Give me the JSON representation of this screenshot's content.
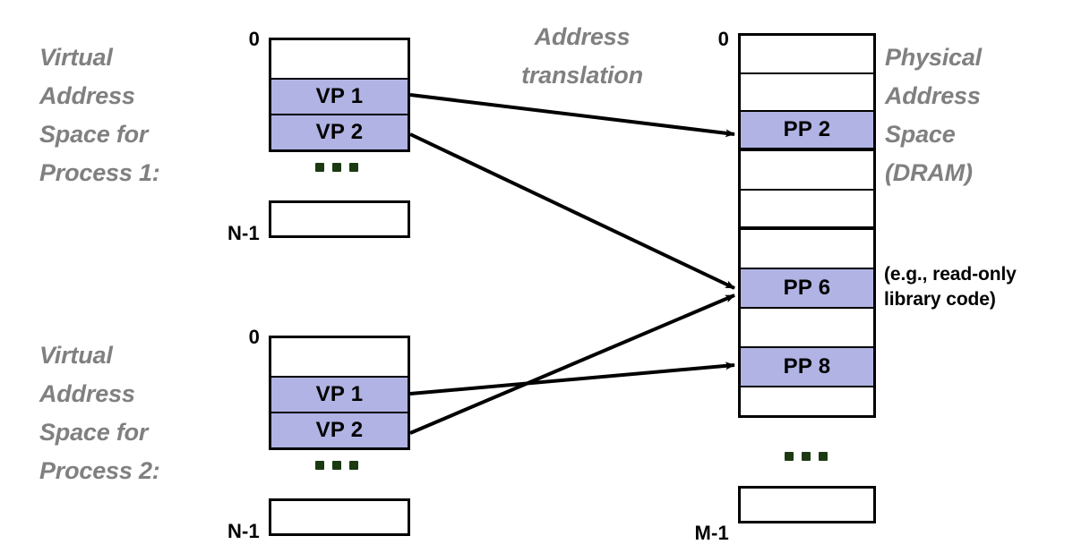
{
  "diagram": {
    "title": "Virtual memory address translation across two processes",
    "colors": {
      "page_fill": "#b0b3e3",
      "caption_gray": "#808080",
      "dot_green": "#1b3a12",
      "stroke": "#000000"
    }
  },
  "captions": {
    "process1": "Virtual\nAddress\nSpace for\nProcess 1:",
    "process2": "Virtual\nAddress\nSpace for\nProcess 2:",
    "translation": "Address\ntranslation",
    "physical": "Physical\nAddress\nSpace\n(DRAM)"
  },
  "notes": {
    "readonly": "(e.g., read-only\nlibrary code)"
  },
  "indices": {
    "vas1_top": "0",
    "vas1_bottom": "N-1",
    "vas2_top": "0",
    "vas2_bottom": "N-1",
    "pas_top": "0",
    "pas_bottom": "M-1"
  },
  "virtual_space_1": {
    "cells": [
      {
        "label": "",
        "filled": false
      },
      {
        "label": "VP 1",
        "filled": true
      },
      {
        "label": "VP 2",
        "filled": true
      }
    ],
    "last_cell": {
      "label": "",
      "filled": false
    }
  },
  "virtual_space_2": {
    "cells": [
      {
        "label": "",
        "filled": false
      },
      {
        "label": "VP 1",
        "filled": true
      },
      {
        "label": "VP 2",
        "filled": true
      }
    ],
    "last_cell": {
      "label": "",
      "filled": false
    }
  },
  "physical_space": {
    "cells": [
      {
        "label": "",
        "filled": false
      },
      {
        "label": "",
        "filled": false
      },
      {
        "label": "PP 2",
        "filled": true
      },
      {
        "label": "",
        "filled": false
      },
      {
        "label": "",
        "filled": false
      },
      {
        "label": "",
        "filled": false
      },
      {
        "label": "PP 6",
        "filled": true
      },
      {
        "label": "",
        "filled": false
      },
      {
        "label": "PP 8",
        "filled": true
      },
      {
        "label": "",
        "filled": false
      }
    ],
    "last_cell": {
      "label": "",
      "filled": false
    }
  },
  "mappings": [
    {
      "from": "process1.VP 1",
      "to": "physical.PP 2"
    },
    {
      "from": "process1.VP 2",
      "to": "physical.PP 6"
    },
    {
      "from": "process2.VP 1",
      "to": "physical.PP 8"
    },
    {
      "from": "process2.VP 2",
      "to": "physical.PP 6"
    }
  ]
}
